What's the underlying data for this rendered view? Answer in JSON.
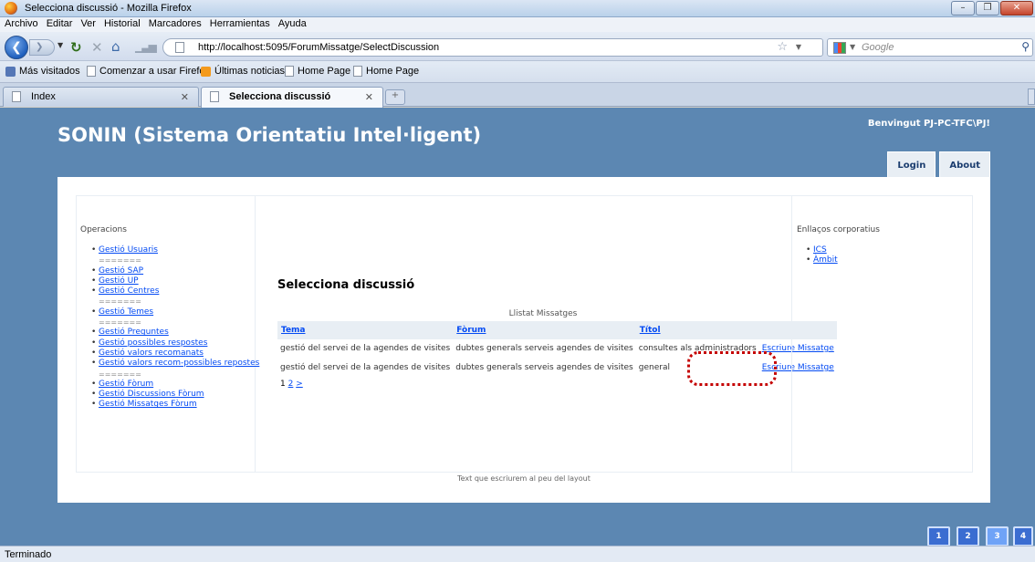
{
  "window": {
    "title": "Selecciona discussió - Mozilla Firefox",
    "min": "–",
    "max": "❐",
    "close": "✕"
  },
  "menu": [
    "Archivo",
    "Editar",
    "Ver",
    "Historial",
    "Marcadores",
    "Herramientas",
    "Ayuda"
  ],
  "nav": {
    "url": "http://localhost:5095/ForumMissatge/SelectDiscussion",
    "search_placeholder": "Google"
  },
  "bookmarks": [
    "Más visitados",
    "Comenzar a usar Firefox",
    "Últimas noticias",
    "Home Page",
    "Home Page"
  ],
  "tabs": [
    {
      "label": "Index"
    },
    {
      "label": "Selecciona discussió"
    }
  ],
  "site": {
    "title": "SONIN (Sistema Orientatiu Intel·ligent)",
    "welcome": "Benvingut PJ-PC-TFC\\PJ!",
    "menu": [
      "Login",
      "About"
    ]
  },
  "left": {
    "title": "Operacions",
    "items": [
      {
        "label": "Gestió Usuaris",
        "type": "link"
      },
      {
        "label": "=======",
        "type": "sep"
      },
      {
        "label": "Gestió SAP",
        "type": "link"
      },
      {
        "label": "Gestió UP",
        "type": "link"
      },
      {
        "label": "Gestió Centres",
        "type": "link"
      },
      {
        "label": "=======",
        "type": "sep"
      },
      {
        "label": "Gestió Temes",
        "type": "link"
      },
      {
        "label": "=======",
        "type": "sep"
      },
      {
        "label": "Gestió Preguntes",
        "type": "link"
      },
      {
        "label": "Gestió possibles respostes",
        "type": "link"
      },
      {
        "label": "Gestió valors recomanats",
        "type": "link"
      },
      {
        "label": "Gestió valors recom-possibles repostes",
        "type": "link"
      },
      {
        "label": "=======",
        "type": "sep"
      },
      {
        "label": "Gestió Fòrum",
        "type": "link"
      },
      {
        "label": "Gestió Discussions Fòrum",
        "type": "link"
      },
      {
        "label": "Gestió Missatges Fòrum",
        "type": "link"
      }
    ]
  },
  "right": {
    "title": "Enllaços corporatius",
    "items": [
      "ICS",
      "Àmbit"
    ]
  },
  "main": {
    "title": "Selecciona discussió",
    "caption": "Llistat Missatges",
    "headers": [
      "Tema",
      "Fòrum",
      "Títol",
      ""
    ],
    "rows": [
      [
        "gestió del servei de la agendes de visites",
        "dubtes generals serveis agendes de visites",
        "consultes als administradors",
        "Escriure Missatge"
      ],
      [
        "gestió del servei de la agendes de visites",
        "dubtes generals serveis agendes de visites",
        "general",
        "Escriure Missatge"
      ]
    ],
    "pager": {
      "current": "1",
      "page2": "2",
      "next": ">"
    }
  },
  "footer": "Text que escriurem al peu del layout",
  "desktops": [
    "1",
    "2",
    "3",
    "4"
  ],
  "status": "Terminado"
}
